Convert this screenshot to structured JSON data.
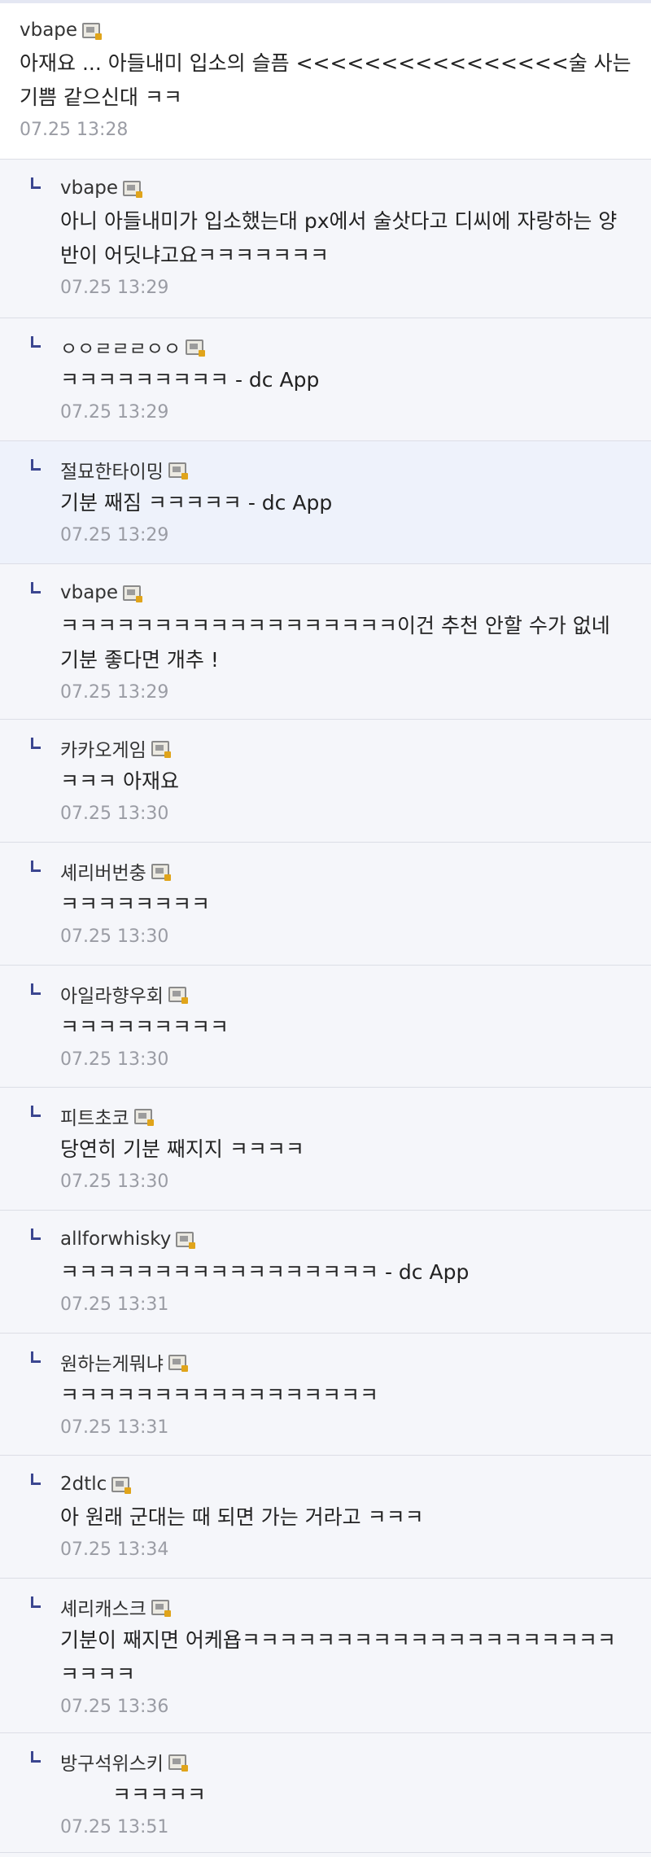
{
  "main_comment": {
    "nick": "vbape",
    "text": "아재요 ... 아들내미 입소의 슬픔 <<<<<<<<<<<<<<<<술 사는 기쁨 같으신대 ㅋㅋ",
    "date": "07.25 13:28"
  },
  "replies": [
    {
      "nick": "vbape",
      "text": "아니 아들내미가 입소했는대 px에서 술삿다고 디씨에 자랑하는 양반이 어딧냐고요ㅋㅋㅋㅋㅋㅋㅋ",
      "date": "07.25 13:29"
    },
    {
      "nick": "ㅇㅇㄹㄹㄹㅇㅇ",
      "text": "ㅋㅋㅋㅋㅋㅋㅋㅋㅋ - dc App",
      "date": "07.25 13:29"
    },
    {
      "nick": "절묘한타이밍",
      "text": "기분 째짐 ㅋㅋㅋㅋㅋ - dc App",
      "date": "07.25 13:29"
    },
    {
      "nick": "vbape",
      "text": "ㅋㅋㅋㅋㅋㅋㅋㅋㅋㅋㅋㅋㅋㅋㅋㅋㅋㅋ이건 추천 안할 수가 없네 기분 좋다면 개추 !",
      "date": "07.25 13:29"
    },
    {
      "nick": "카카오게임",
      "text": "ㅋㅋㅋ 아재요",
      "date": "07.25 13:30"
    },
    {
      "nick": "셰리버번충",
      "text": "ㅋㅋㅋㅋㅋㅋㅋㅋ",
      "date": "07.25 13:30"
    },
    {
      "nick": "아일라향우회",
      "text": "ㅋㅋㅋㅋㅋㅋㅋㅋㅋ",
      "date": "07.25 13:30"
    },
    {
      "nick": "피트초코",
      "text": "당연히 기분 째지지 ㅋㅋㅋㅋ",
      "date": "07.25 13:30"
    },
    {
      "nick": "allforwhisky",
      "text": "ㅋㅋㅋㅋㅋㅋㅋㅋㅋㅋㅋㅋㅋㅋㅋㅋㅋ - dc App",
      "date": "07.25 13:31"
    },
    {
      "nick": "원하는게뭐냐",
      "text": "ㅋㅋㅋㅋㅋㅋㅋㅋㅋㅋㅋㅋㅋㅋㅋㅋㅋ",
      "date": "07.25 13:31"
    },
    {
      "nick": "2dtlc",
      "text": "아 원래 군대는 때 되면 가는 거라고 ㅋㅋㅋ",
      "date": "07.25 13:34"
    },
    {
      "nick": "셰리캐스크",
      "text": "기분이 째지면 어케욥ㅋㅋㅋㅋㅋㅋㅋㅋㅋㅋㅋㅋㅋㅋㅋㅋㅋㅋㅋㅋㅋㅋㅋㅋ",
      "date": "07.25 13:36"
    },
    {
      "nick": "방구석위스키",
      "text": "ㅋㅋㅋㅋㅋ",
      "date": "07.25 13:51"
    }
  ],
  "icons": {
    "gallog": "gallog-icon",
    "reply": "reply-arrow-icon"
  },
  "colors": {
    "highlight_bg": "#eef2fb",
    "reply_mark": "#3b4690",
    "date_text": "#9a9ca4"
  }
}
